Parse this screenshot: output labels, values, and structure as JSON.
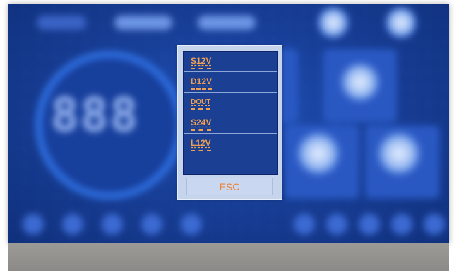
{
  "menu": {
    "items": [
      {
        "label": "S12V"
      },
      {
        "label": "D12V"
      },
      {
        "label": "DOUT"
      },
      {
        "label": "S24V"
      },
      {
        "label": "L12V"
      }
    ],
    "esc_label": "ESC"
  },
  "background": {
    "display_digits": "888"
  },
  "colors": {
    "screen_bg": "#183f98",
    "menu_frame": "#c6d4ec",
    "menu_list_bg": "#1a3f93",
    "menu_text": "#f0a050",
    "esc_text": "#f08030",
    "bottom_bar": "#96948f"
  }
}
